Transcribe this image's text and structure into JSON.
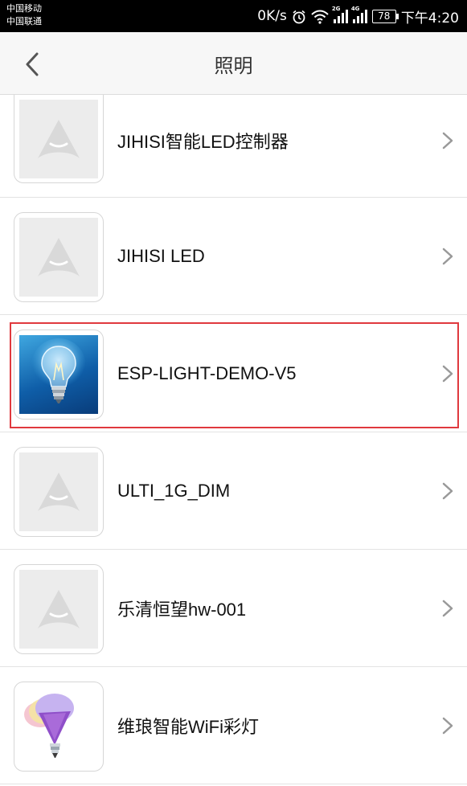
{
  "status_bar": {
    "carrier_1": "中国移动",
    "carrier_2": "中国联通",
    "net_speed": "0K/s",
    "signal_1_tag": "2G",
    "signal_2_tag": "4G",
    "battery": "78",
    "time": "下午4:20"
  },
  "header": {
    "title": "照明"
  },
  "devices": [
    {
      "name": "JIHISI智能LED控制器",
      "icon": "placeholder-icon"
    },
    {
      "name": "JIHISI LED",
      "icon": "placeholder-icon"
    },
    {
      "name": "ESP-LIGHT-DEMO-V5",
      "icon": "light-bulb-icon"
    },
    {
      "name": "ULTI_1G_DIM",
      "icon": "placeholder-icon"
    },
    {
      "name": "乐清恒望hw-001",
      "icon": "placeholder-icon"
    },
    {
      "name": "维琅智能WiFi彩灯",
      "icon": "rgb-bulb-icon"
    }
  ],
  "colors": {
    "highlight": "#e0393e",
    "header_bg": "#f7f7f7",
    "status_bar_bg": "#000000"
  }
}
